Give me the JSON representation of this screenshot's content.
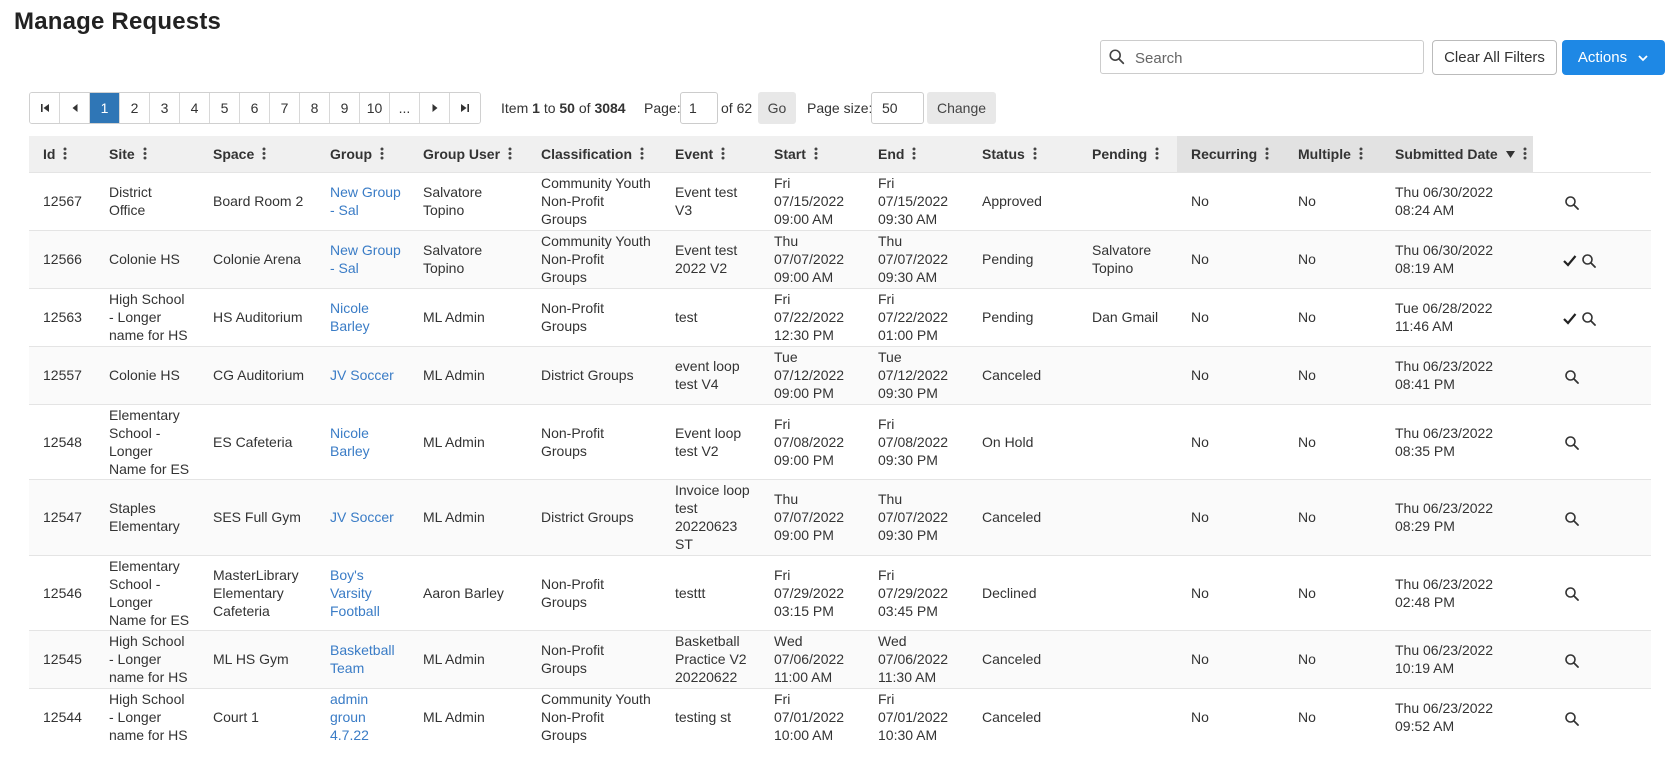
{
  "page": {
    "title": "Manage Requests"
  },
  "toolbar": {
    "search_placeholder": "Search",
    "clear_filters_label": "Clear All Filters",
    "actions_label": "Actions"
  },
  "pager": {
    "pages": [
      "1",
      "2",
      "3",
      "4",
      "5",
      "6",
      "7",
      "8",
      "9",
      "10",
      "..."
    ],
    "active_page": "1",
    "item_prefix": "Item",
    "item_from": "1",
    "item_to_word": "to",
    "item_to": "50",
    "item_of_word": "of",
    "item_total": "3084",
    "page_label": "Page:",
    "page_value": "1",
    "of_pages": "of 62",
    "go_label": "Go",
    "size_label": "Page size:",
    "size_value": "50",
    "change_label": "Change"
  },
  "table": {
    "columns": [
      "Id",
      "Site",
      "Space",
      "Group",
      "Group User",
      "Classification",
      "Event",
      "Start",
      "End",
      "Status",
      "Pending",
      "Recurring",
      "Multiple",
      "Submitted Date"
    ],
    "sorted_column": "Submitted Date",
    "sort_direction": "descending",
    "rows": [
      {
        "id": "12567",
        "site": "District Office",
        "space": "Board Room 2",
        "group": "New Group - Sal",
        "group_user": "Salvatore Topino",
        "classification": "Community Youth Non-Profit Groups",
        "event": "Event test V3",
        "start": "Fri 07/15/2022 09:00 AM",
        "end": "Fri 07/15/2022 09:30 AM",
        "status": "Approved",
        "pending": "",
        "recurring": "No",
        "multiple": "No",
        "submitted": "Thu 06/30/2022 08:24 AM",
        "can_approve": false
      },
      {
        "id": "12566",
        "site": "Colonie HS",
        "space": "Colonie Arena",
        "group": "New Group - Sal",
        "group_user": "Salvatore Topino",
        "classification": "Community Youth Non-Profit Groups",
        "event": "Event test 2022 V2",
        "start": "Thu 07/07/2022 09:00 AM",
        "end": "Thu 07/07/2022 09:30 AM",
        "status": "Pending",
        "pending": "Salvatore Topino",
        "recurring": "No",
        "multiple": "No",
        "submitted": "Thu 06/30/2022 08:19 AM",
        "can_approve": true
      },
      {
        "id": "12563",
        "site": "High School - Longer name for HS",
        "space": "HS Auditorium",
        "group": "Nicole Barley",
        "group_user": "ML Admin",
        "classification": "Non-Profit Groups",
        "event": "test",
        "start": "Fri 07/22/2022 12:30 PM",
        "end": "Fri 07/22/2022 01:00 PM",
        "status": "Pending",
        "pending": "Dan Gmail",
        "recurring": "No",
        "multiple": "No",
        "submitted": "Tue 06/28/2022 11:46 AM",
        "can_approve": true
      },
      {
        "id": "12557",
        "site": "Colonie HS",
        "space": "CG Auditorium",
        "group": "JV Soccer",
        "group_user": "ML Admin",
        "classification": "District Groups",
        "event": "event loop test V4",
        "start": "Tue 07/12/2022 09:00 PM",
        "end": "Tue 07/12/2022 09:30 PM",
        "status": "Canceled",
        "pending": "",
        "recurring": "No",
        "multiple": "No",
        "submitted": "Thu 06/23/2022 08:41 PM",
        "can_approve": false
      },
      {
        "id": "12548",
        "site": "Elementary School - Longer Name for ES",
        "space": "ES Cafeteria",
        "group": "Nicole Barley",
        "group_user": "ML Admin",
        "classification": "Non-Profit Groups",
        "event": "Event loop test V2",
        "start": "Fri 07/08/2022 09:00 PM",
        "end": "Fri 07/08/2022 09:30 PM",
        "status": "On Hold",
        "pending": "",
        "recurring": "No",
        "multiple": "No",
        "submitted": "Thu 06/23/2022 08:35 PM",
        "can_approve": false
      },
      {
        "id": "12547",
        "site": "Staples Elementary",
        "space": "SES Full Gym",
        "group": "JV Soccer",
        "group_user": "ML Admin",
        "classification": "District Groups",
        "event": "Invoice loop test 20220623 ST",
        "start": "Thu 07/07/2022 09:00 PM",
        "end": "Thu 07/07/2022 09:30 PM",
        "status": "Canceled",
        "pending": "",
        "recurring": "No",
        "multiple": "No",
        "submitted": "Thu 06/23/2022 08:29 PM",
        "can_approve": false
      },
      {
        "id": "12546",
        "site": "Elementary School - Longer Name for ES",
        "space": "MasterLibrary Elementary Cafeteria",
        "group": "Boy's Varsity Football",
        "group_user": "Aaron Barley",
        "classification": "Non-Profit Groups",
        "event": "testtt",
        "start": "Fri 07/29/2022 03:15 PM",
        "end": "Fri 07/29/2022 03:45 PM",
        "status": "Declined",
        "pending": "",
        "recurring": "No",
        "multiple": "No",
        "submitted": "Thu 06/23/2022 02:48 PM",
        "can_approve": false
      },
      {
        "id": "12545",
        "site": "High School - Longer name for HS",
        "space": "ML HS Gym",
        "group": "Basketball Team",
        "group_user": "ML Admin",
        "classification": "Non-Profit Groups",
        "event": "Basketball Practice V2 20220622",
        "start": "Wed 07/06/2022 11:00 AM",
        "end": "Wed 07/06/2022 11:30 AM",
        "status": "Canceled",
        "pending": "",
        "recurring": "No",
        "multiple": "No",
        "submitted": "Thu 06/23/2022 10:19 AM",
        "can_approve": false
      },
      {
        "id": "12544",
        "site": "High School - Longer name for HS",
        "space": "Court 1",
        "group": "admin groun 4.7.22",
        "group_user": "ML Admin",
        "classification": "Community Youth Non-Profit Groups",
        "event": "testing st",
        "start": "Fri 07/01/2022 10:00 AM",
        "end": "Fri 07/01/2022 10:30 AM",
        "status": "Canceled",
        "pending": "",
        "recurring": "No",
        "multiple": "No",
        "submitted": "Thu 06/23/2022 09:52 AM",
        "can_approve": false
      }
    ]
  },
  "icons": {
    "search": "magnifier",
    "view": "magnifier",
    "approve": "checkmark",
    "column_menu": "vertical-ellipsis",
    "sort_desc": "triangle-down"
  },
  "colors": {
    "accent": "#1e88e5",
    "active_page": "#2f76b6",
    "link": "#3a7cc6",
    "header_bg": "#f0f0f0",
    "header_sorted_bg": "#e2e2e2"
  }
}
